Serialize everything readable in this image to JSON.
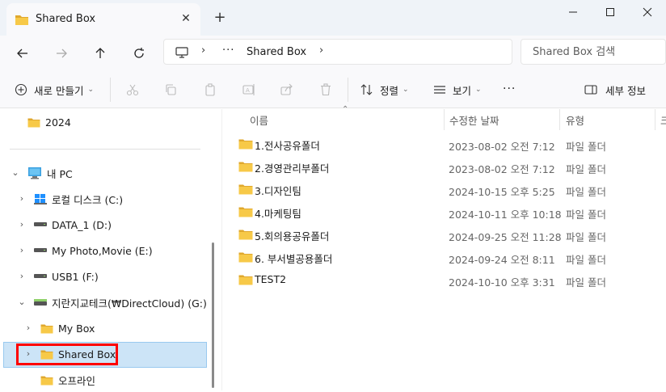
{
  "window": {
    "tab_title": "Shared Box",
    "tab_close": "✕",
    "new_tab": "+"
  },
  "nav": {
    "breadcrumb_more": "···",
    "breadcrumb_sep": "›",
    "breadcrumb_current": "Shared Box",
    "search_placeholder": "Shared Box 검색"
  },
  "toolbar": {
    "new_label": "새로 만들기",
    "sort_label": "정렬",
    "view_label": "보기",
    "more_label": "···",
    "details_label": "세부 정보"
  },
  "sidebar": {
    "items": [
      {
        "label": "2024"
      },
      {
        "label": "내 PC"
      },
      {
        "label": "로컬 디스크 (C:)"
      },
      {
        "label": "DATA_1 (D:)"
      },
      {
        "label": "My Photo,Movie (E:)"
      },
      {
        "label": "USB1 (F:)"
      },
      {
        "label": "지란지교테크(₩DirectCloud) (G:)"
      },
      {
        "label": "My Box"
      },
      {
        "label": "Shared Box"
      },
      {
        "label": "오프라인"
      }
    ]
  },
  "columns": {
    "name": "이름",
    "date": "수정한 날짜",
    "type": "유형",
    "size": "크"
  },
  "files": [
    {
      "name": "1.전사공유폴더",
      "date": "2023-08-02 오전 7:12",
      "type": "파일 폴더"
    },
    {
      "name": "2.경영관리부폴더",
      "date": "2023-08-02 오전 7:12",
      "type": "파일 폴더"
    },
    {
      "name": "3.디자인팀",
      "date": "2024-10-15 오후 5:25",
      "type": "파일 폴더"
    },
    {
      "name": "4.마케팅팀",
      "date": "2024-10-11 오후 10:18",
      "type": "파일 폴더"
    },
    {
      "name": "5.회의용공유폴더",
      "date": "2024-09-25 오전 11:28",
      "type": "파일 폴더"
    },
    {
      "name": "6. 부서별공용폴더",
      "date": "2024-09-24 오전 8:11",
      "type": "파일 폴더"
    },
    {
      "name": "TEST2",
      "date": "2024-10-10 오후 3:31",
      "type": "파일 폴더"
    }
  ],
  "colors": {
    "folder": "#f7c948",
    "folder_dark": "#e0a82e",
    "selection": "#cce4f7",
    "highlight": "#ff0000"
  }
}
